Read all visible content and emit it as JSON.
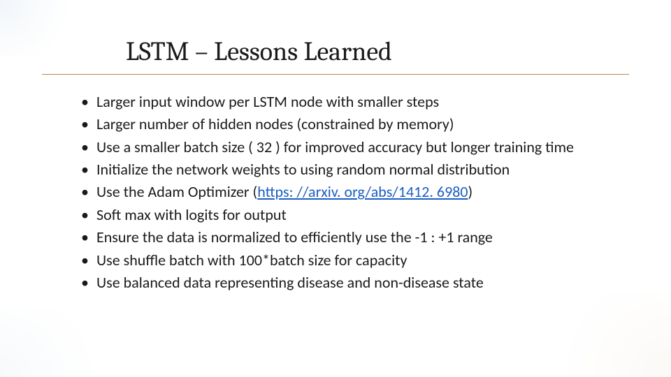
{
  "slide": {
    "title": "LSTM – Lessons Learned",
    "bullets": [
      "Larger input window per LSTM node with smaller steps",
      "Larger number of hidden nodes (constrained by memory)",
      "Use a smaller batch size ( 32 ) for improved accuracy but longer training time",
      "Initialize the network weights to using random normal distribution",
      "Use the Adam Optimizer (",
      "Soft max with logits for output",
      "Ensure the data is normalized to efficiently use the -1 : +1 range",
      "Use shuffle batch with 100*batch size for capacity",
      "Use balanced data representing disease and non-disease state"
    ],
    "link": {
      "text": "https: //arxiv. org/abs/1412. 6980",
      "after": ")"
    }
  }
}
